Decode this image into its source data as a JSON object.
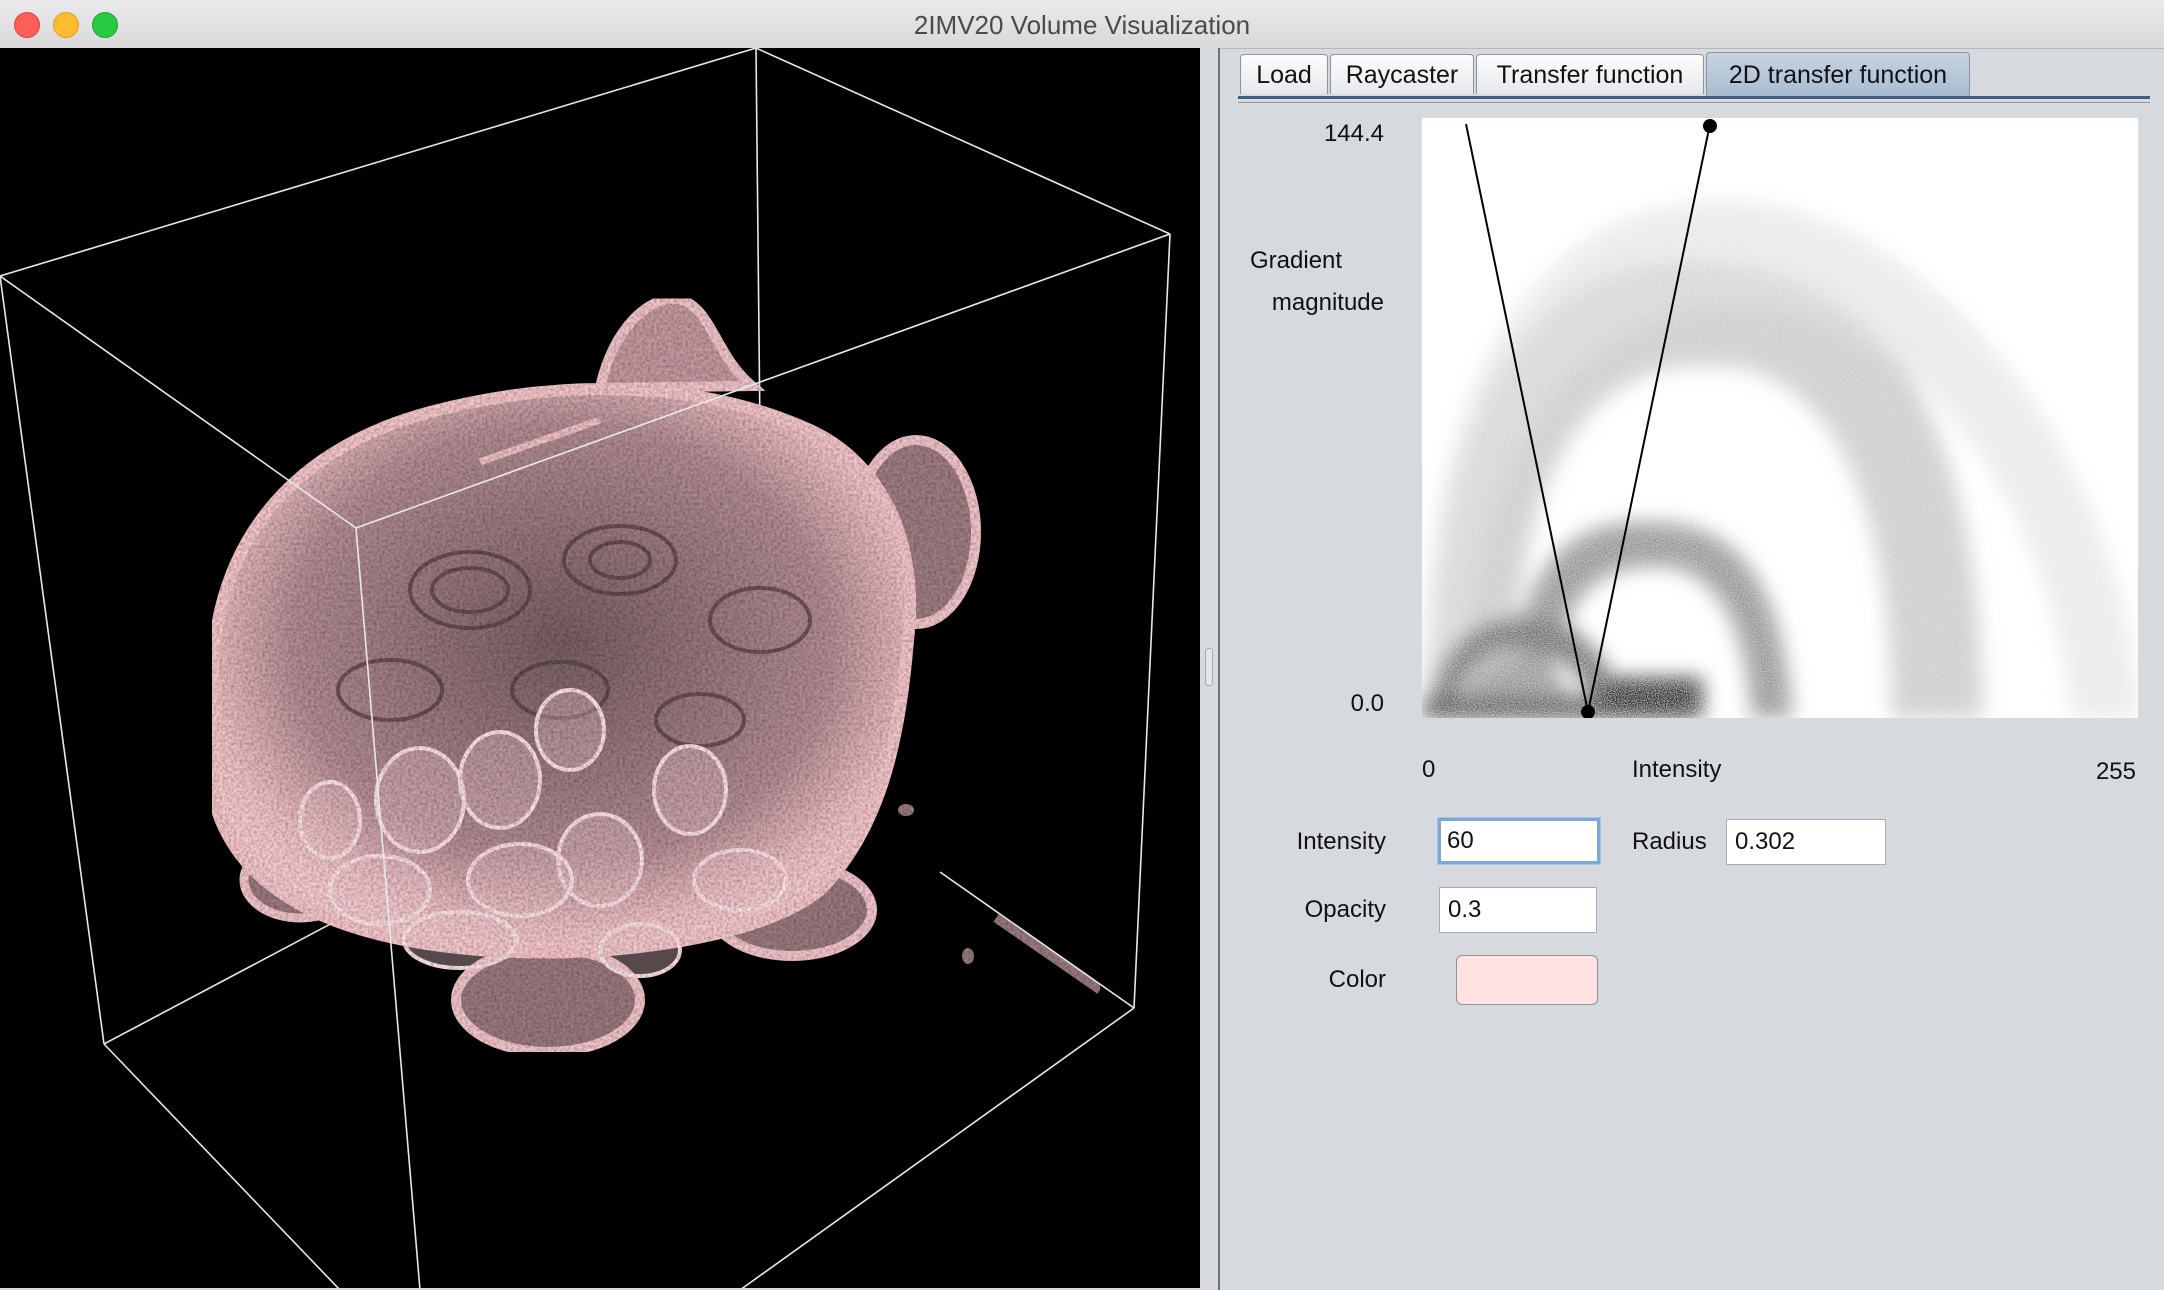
{
  "window": {
    "title": "2IMV20 Volume Visualization"
  },
  "tabs": [
    {
      "label": "Load"
    },
    {
      "label": "Raycaster"
    },
    {
      "label": "Transfer function"
    },
    {
      "label": "2D transfer function",
      "active": true
    }
  ],
  "tf2d": {
    "y_max_label": "144.4",
    "y_min_label": "0.0",
    "y_axis_label_line1": "Gradient",
    "y_axis_label_line2": "magnitude",
    "x_min_label": "0",
    "x_axis_label": "Intensity",
    "x_max_label": "255",
    "triangle": {
      "base_intensity": 60,
      "radius": 0.302,
      "top_gradient": 144.4
    }
  },
  "controls": {
    "intensity_label": "Intensity",
    "intensity_value": "60",
    "radius_label": "Radius",
    "radius_value": "0.302",
    "opacity_label": "Opacity",
    "opacity_value": "0.3",
    "color_label": "Color",
    "color_value": "#ffe1e1"
  },
  "render": {
    "volume_color": "#f7c3c8",
    "background": "#000000",
    "box_color": "#ffffff"
  }
}
